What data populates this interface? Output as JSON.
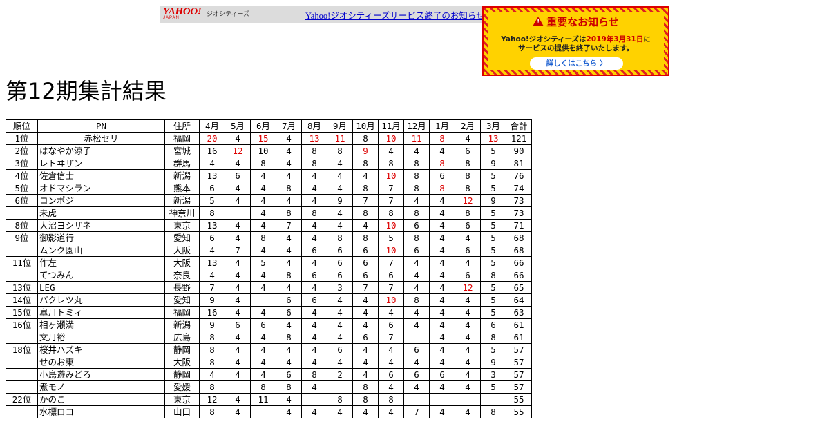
{
  "banner": {
    "logo": "YAHOO!",
    "logo_sub": "JAPAN",
    "logo_text": "ジオシティーズ",
    "link_text": "Yahoo!ジオシティーズサービス終了のお知らせ"
  },
  "notice": {
    "title": "重要なお知らせ",
    "line1_a": "Yahoo!ジオシティーズは",
    "line1_b": "2019年3月31日",
    "line1_c": "に",
    "line2": "サービスの提供を終了いたします。",
    "button": "詳しくはこちら",
    "button_arrow": "〉"
  },
  "title": "第12期集計結果",
  "colors": {
    "highlight": "#dd0000",
    "link": "#0000cc",
    "notice_bg": "#ffd200"
  },
  "table": {
    "headers": [
      "順位",
      "PN",
      "住所",
      "4月",
      "5月",
      "6月",
      "7月",
      "8月",
      "9月",
      "10月",
      "11月",
      "12月",
      "1月",
      "2月",
      "3月",
      "合計"
    ],
    "rows": [
      {
        "rank": "1位",
        "pn": "赤松セリ",
        "loc": "福岡",
        "m": [
          "20",
          "4",
          "15",
          "4",
          "13",
          "11",
          "8",
          "10",
          "11",
          "8",
          "4",
          "13"
        ],
        "red": [
          0,
          2,
          4,
          5,
          7,
          8,
          9,
          11
        ],
        "total": "121",
        "pn_center": true
      },
      {
        "rank": "2位",
        "pn": "はなやか涼子",
        "loc": "宮城",
        "m": [
          "16",
          "12",
          "10",
          "4",
          "8",
          "8",
          "9",
          "4",
          "4",
          "4",
          "6",
          "5"
        ],
        "red": [
          1,
          6
        ],
        "total": "90"
      },
      {
        "rank": "3位",
        "pn": "レトヰザン",
        "loc": "群馬",
        "m": [
          "4",
          "4",
          "8",
          "4",
          "8",
          "4",
          "8",
          "8",
          "8",
          "8",
          "8",
          "9"
        ],
        "red": [
          9
        ],
        "total": "81"
      },
      {
        "rank": "4位",
        "pn": "佐倉信士",
        "loc": "新潟",
        "m": [
          "13",
          "6",
          "4",
          "4",
          "4",
          "4",
          "4",
          "10",
          "8",
          "6",
          "8",
          "5"
        ],
        "red": [
          7
        ],
        "total": "76"
      },
      {
        "rank": "5位",
        "pn": "オドマシラン",
        "loc": "熊本",
        "m": [
          "6",
          "4",
          "4",
          "8",
          "4",
          "4",
          "8",
          "7",
          "8",
          "8",
          "8",
          "5"
        ],
        "red": [
          9
        ],
        "total": "74"
      },
      {
        "rank": "6位",
        "pn": "コンポジ",
        "loc": "新潟",
        "m": [
          "5",
          "4",
          "4",
          "4",
          "4",
          "9",
          "7",
          "7",
          "4",
          "4",
          "12",
          "9"
        ],
        "red": [
          10
        ],
        "total": "73"
      },
      {
        "rank": "",
        "pn": "未虎",
        "loc": "神奈川",
        "m": [
          "8",
          "",
          "4",
          "8",
          "8",
          "4",
          "8",
          "8",
          "8",
          "4",
          "8",
          "5"
        ],
        "red": [],
        "total": "73"
      },
      {
        "rank": "8位",
        "pn": "大沼ヨシザネ",
        "loc": "東京",
        "m": [
          "13",
          "4",
          "4",
          "7",
          "4",
          "4",
          "4",
          "10",
          "6",
          "4",
          "6",
          "5"
        ],
        "red": [
          7
        ],
        "total": "71"
      },
      {
        "rank": "9位",
        "pn": "御影道行",
        "loc": "愛知",
        "m": [
          "6",
          "4",
          "8",
          "4",
          "4",
          "8",
          "8",
          "5",
          "8",
          "4",
          "4",
          "5"
        ],
        "red": [],
        "total": "68"
      },
      {
        "rank": "",
        "pn": "ムンク園山",
        "loc": "大阪",
        "m": [
          "4",
          "7",
          "4",
          "4",
          "6",
          "6",
          "6",
          "10",
          "6",
          "4",
          "6",
          "5"
        ],
        "red": [
          7
        ],
        "total": "68"
      },
      {
        "rank": "11位",
        "pn": "作左",
        "loc": "大阪",
        "m": [
          "13",
          "4",
          "5",
          "4",
          "4",
          "6",
          "6",
          "7",
          "4",
          "4",
          "4",
          "5"
        ],
        "red": [],
        "total": "66"
      },
      {
        "rank": "",
        "pn": "てつみん",
        "loc": "奈良",
        "m": [
          "4",
          "4",
          "4",
          "8",
          "6",
          "6",
          "6",
          "6",
          "4",
          "4",
          "6",
          "8"
        ],
        "red": [],
        "total": "66"
      },
      {
        "rank": "13位",
        "pn": "LEG",
        "loc": "長野",
        "m": [
          "7",
          "4",
          "4",
          "4",
          "4",
          "3",
          "7",
          "7",
          "4",
          "4",
          "12",
          "5"
        ],
        "red": [
          10
        ],
        "total": "65"
      },
      {
        "rank": "14位",
        "pn": "バクレツ丸",
        "loc": "愛知",
        "m": [
          "9",
          "4",
          "",
          "6",
          "6",
          "4",
          "4",
          "10",
          "8",
          "4",
          "4",
          "5"
        ],
        "red": [
          7
        ],
        "total": "64"
      },
      {
        "rank": "15位",
        "pn": "皐月トミィ",
        "loc": "福岡",
        "m": [
          "16",
          "4",
          "4",
          "6",
          "4",
          "4",
          "4",
          "4",
          "4",
          "4",
          "4",
          "5"
        ],
        "red": [],
        "total": "63"
      },
      {
        "rank": "16位",
        "pn": "相ヶ瀬満",
        "loc": "新潟",
        "m": [
          "9",
          "6",
          "6",
          "4",
          "4",
          "4",
          "4",
          "6",
          "4",
          "4",
          "4",
          "6"
        ],
        "red": [],
        "total": "61"
      },
      {
        "rank": "",
        "pn": "文月裕",
        "loc": "広島",
        "m": [
          "8",
          "4",
          "4",
          "8",
          "4",
          "4",
          "6",
          "7",
          "",
          "4",
          "4",
          "8"
        ],
        "red": [],
        "total": "61"
      },
      {
        "rank": "18位",
        "pn": "桜井ハズキ",
        "loc": "静岡",
        "m": [
          "8",
          "4",
          "4",
          "4",
          "4",
          "6",
          "4",
          "4",
          "6",
          "4",
          "4",
          "5"
        ],
        "red": [],
        "total": "57"
      },
      {
        "rank": "",
        "pn": "せのお東",
        "loc": "大阪",
        "m": [
          "8",
          "4",
          "4",
          "4",
          "4",
          "4",
          "4",
          "4",
          "4",
          "4",
          "4",
          "9"
        ],
        "red": [],
        "total": "57"
      },
      {
        "rank": "",
        "pn": "小鳥遊みどろ",
        "loc": "静岡",
        "m": [
          "4",
          "4",
          "4",
          "6",
          "8",
          "2",
          "4",
          "6",
          "6",
          "6",
          "4",
          "3"
        ],
        "red": [],
        "total": "57"
      },
      {
        "rank": "",
        "pn": "煮モノ",
        "loc": "愛媛",
        "m": [
          "8",
          "",
          "8",
          "8",
          "4",
          "",
          "8",
          "4",
          "4",
          "4",
          "4",
          "5"
        ],
        "red": [],
        "total": "57"
      },
      {
        "rank": "22位",
        "pn": "かのこ",
        "loc": "東京",
        "m": [
          "12",
          "4",
          "11",
          "4",
          "",
          "8",
          "8",
          "8",
          "",
          "",
          "",
          ""
        ],
        "red": [],
        "total": "55"
      },
      {
        "rank": "",
        "pn": "水標ロコ",
        "loc": "山口",
        "m": [
          "8",
          "4",
          "",
          "4",
          "4",
          "4",
          "4",
          "4",
          "7",
          "4",
          "4",
          "8"
        ],
        "red": [],
        "total": "55"
      }
    ]
  }
}
